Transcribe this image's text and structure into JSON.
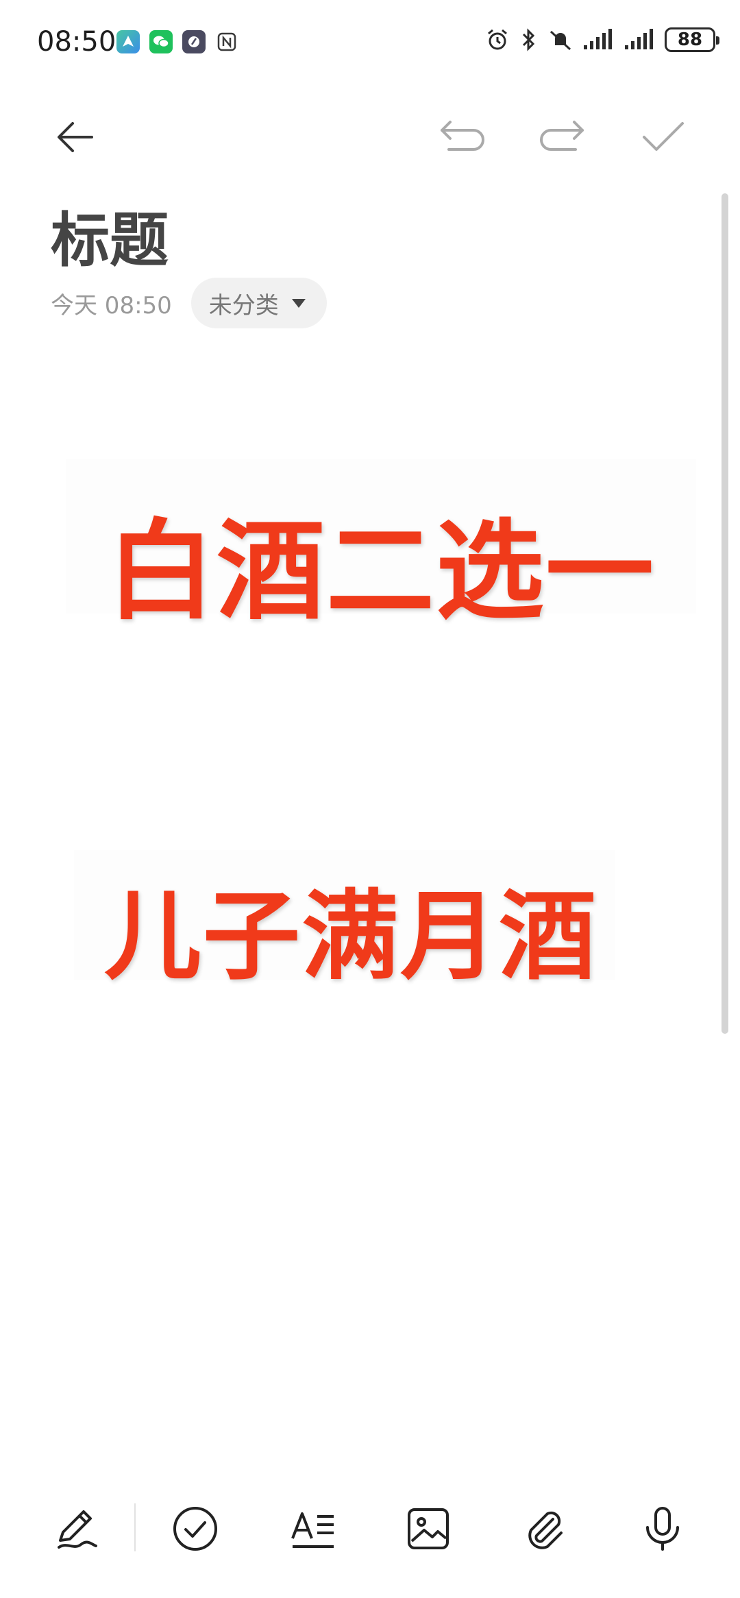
{
  "status_bar": {
    "time": "08:50",
    "battery": "88",
    "app_icons": [
      "maps-icon",
      "wechat-icon",
      "app-icon",
      "nfc-icon"
    ],
    "system_icons": [
      "alarm-icon",
      "bluetooth-icon",
      "mute-icon",
      "signal-icon",
      "signal-icon"
    ]
  },
  "toolbar": {
    "icons": [
      "back-arrow-icon",
      "undo-icon",
      "redo-icon",
      "check-icon"
    ]
  },
  "note": {
    "title": "标题",
    "date": "今天 08:50",
    "category": "未分类"
  },
  "content_image": {
    "line1": "白酒二选一",
    "line2": "儿子满月酒",
    "text_color": "#f03a1a"
  },
  "bottom_bar": {
    "icons": [
      "handwriting-icon",
      "checklist-icon",
      "text-format-icon",
      "image-icon",
      "attachment-icon",
      "microphone-icon"
    ]
  }
}
